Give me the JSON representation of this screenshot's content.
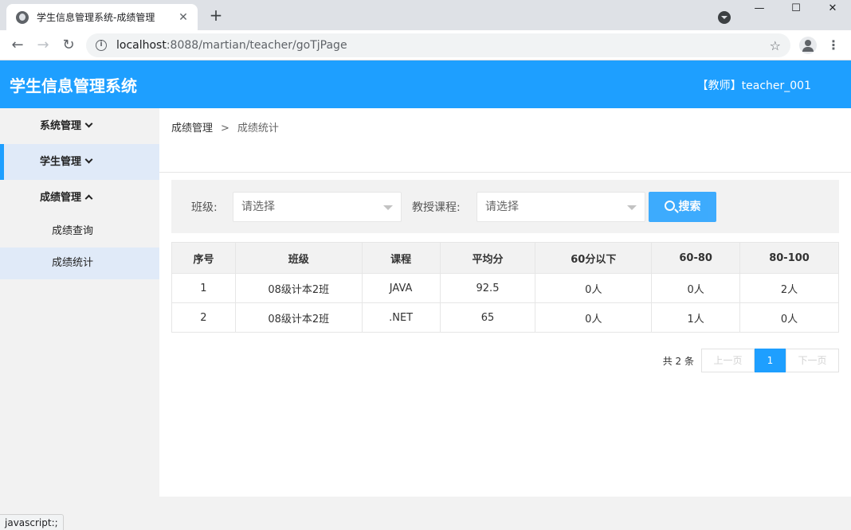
{
  "browser": {
    "tab_title": "学生信息管理系统-成绩管理",
    "tab_close": "✕",
    "new_tab": "+",
    "url_host": "localhost",
    "url_path": ":8088/martian/teacher/goTjPage",
    "status_text": "javascript:;",
    "win_min": "—",
    "win_max": "☐",
    "win_close": "✕",
    "back": "←",
    "forward": "→",
    "reload": "↻",
    "star": "☆",
    "menu": "⋮"
  },
  "header": {
    "title": "学生信息管理系统",
    "user": "【教师】teacher_001"
  },
  "sidebar": {
    "groups": [
      {
        "label": "系统管理"
      },
      {
        "label": "学生管理"
      },
      {
        "label": "成绩管理"
      }
    ],
    "subitems": [
      {
        "label": "成绩查询"
      },
      {
        "label": "成绩统计"
      }
    ]
  },
  "breadcrumb": {
    "parent": "成绩管理",
    "separator": ">",
    "current": "成绩统计"
  },
  "search": {
    "class_label": "班级:",
    "class_placeholder": "请选择",
    "course_label": "教授课程:",
    "course_placeholder": "请选择",
    "button_label": "搜索"
  },
  "table": {
    "columns": [
      "序号",
      "班级",
      "课程",
      "平均分",
      "60分以下",
      "60-80",
      "80-100"
    ],
    "rows": [
      [
        "1",
        "08级计本2班",
        "JAVA",
        "92.5",
        "0人",
        "0人",
        "2人"
      ],
      [
        "2",
        "08级计本2班",
        ".NET",
        "65",
        "0人",
        "1人",
        "0人"
      ]
    ]
  },
  "pager": {
    "count": "共 2 条",
    "prev": "上一页",
    "current": "1",
    "next": "下一页"
  }
}
